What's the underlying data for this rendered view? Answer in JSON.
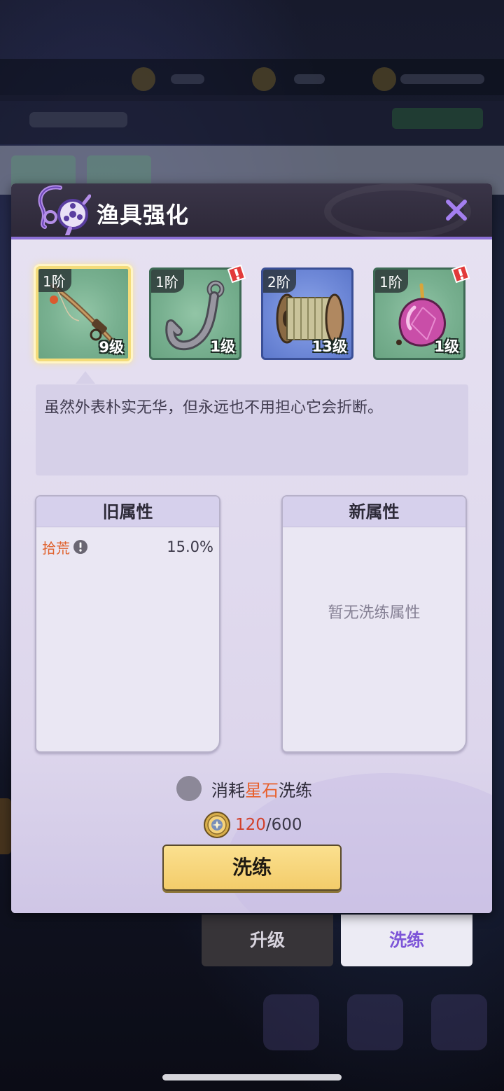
{
  "dialog": {
    "title": "渔具强化",
    "description": "虽然外表朴实无华，但永远也不用担心它会折断。"
  },
  "equipment": [
    {
      "tier": "1阶",
      "level": "9级",
      "icon": "fishing-rod-icon",
      "selected": true,
      "alert": false,
      "color": "#7fb597"
    },
    {
      "tier": "1阶",
      "level": "1级",
      "icon": "fishing-hook-icon",
      "selected": false,
      "alert": true,
      "color": "#7fb597"
    },
    {
      "tier": "2阶",
      "level": "13级",
      "icon": "fishing-line-spool-icon",
      "selected": false,
      "alert": false,
      "color": "#7189d8"
    },
    {
      "tier": "1阶",
      "level": "1级",
      "icon": "bait-gem-icon",
      "selected": false,
      "alert": true,
      "color": "#7fb597"
    }
  ],
  "old_attributes": {
    "header": "旧属性",
    "rows": [
      {
        "name": "拾荒",
        "value": "15.0%"
      }
    ]
  },
  "new_attributes": {
    "header": "新属性",
    "empty_text": "暂无洗练属性"
  },
  "consume": {
    "prefix": "消耗",
    "highlight": "星石",
    "suffix": "洗练",
    "checked": false
  },
  "cost": {
    "current": "120",
    "separator": "/",
    "required": "600"
  },
  "refine_button": "洗练",
  "tabs": {
    "upgrade": "升级",
    "refine": "洗练"
  },
  "colors": {
    "accent_purple": "#8b6fd6",
    "button_yellow": "#f8d97e",
    "highlight_orange": "#e8602c",
    "cost_red": "#d2402a"
  }
}
